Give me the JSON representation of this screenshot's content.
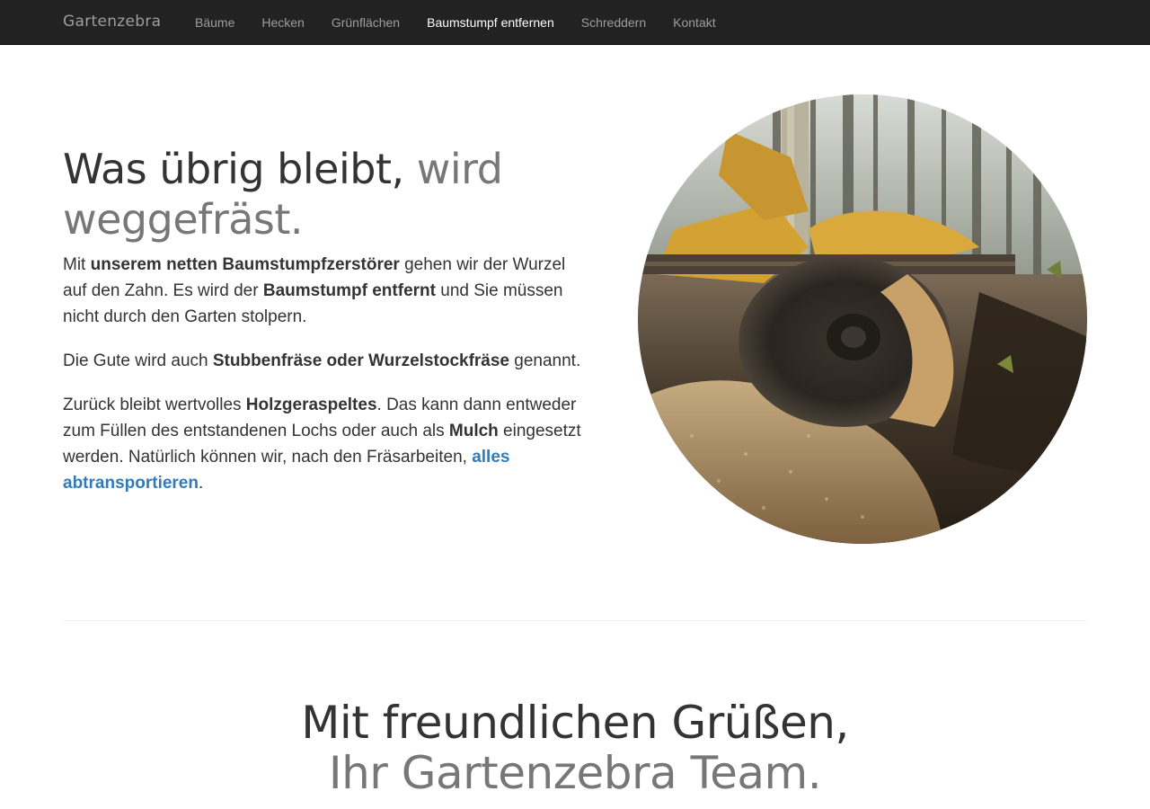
{
  "nav": {
    "brand": "Gartenzebra",
    "items": [
      {
        "label": "Bäume"
      },
      {
        "label": "Hecken"
      },
      {
        "label": "Grünflächen"
      },
      {
        "label": "Baumstumpf entfernen",
        "active": true
      },
      {
        "label": "Schreddern"
      },
      {
        "label": "Kontakt"
      }
    ]
  },
  "hero": {
    "heading_main": "Was übrig bleibt,",
    "heading_muted": "wird weggefräst.",
    "p1": {
      "t1": "Mit ",
      "b1": "unserem netten Baumstumpfzerstörer",
      "t2": " gehen wir der Wurzel auf den Zahn. Es wird der ",
      "b2": "Baumstumpf entfernt",
      "t3": " und Sie müssen nicht durch den Garten stolpern."
    },
    "p2": {
      "t1": "Die Gute wird auch ",
      "b1": "Stubbenfräse oder Wurzelstockfräse",
      "t2": " genannt."
    },
    "p3": {
      "t1": "Zurück bleibt wertvolles ",
      "b1": "Holzgeraspeltes",
      "t2": ". Das kann dann entweder zum Füllen des entstandenen Lochs oder auch als ",
      "b2": "Mulch",
      "t3": " eingesetzt werden. Natürlich können wir, nach den Fräsarbeiten, ",
      "link": "alles abtransportieren",
      "t4": "."
    }
  },
  "closing": {
    "line1": "Mit freundlichen Grüßen,",
    "line2": "Ihr Gartenzebra Team."
  },
  "colors": {
    "navbar_bg": "#222222",
    "nav_text": "#9d9d9d",
    "nav_active": "#ffffff",
    "text": "#333333",
    "muted": "#777777",
    "link": "#337ab7"
  }
}
